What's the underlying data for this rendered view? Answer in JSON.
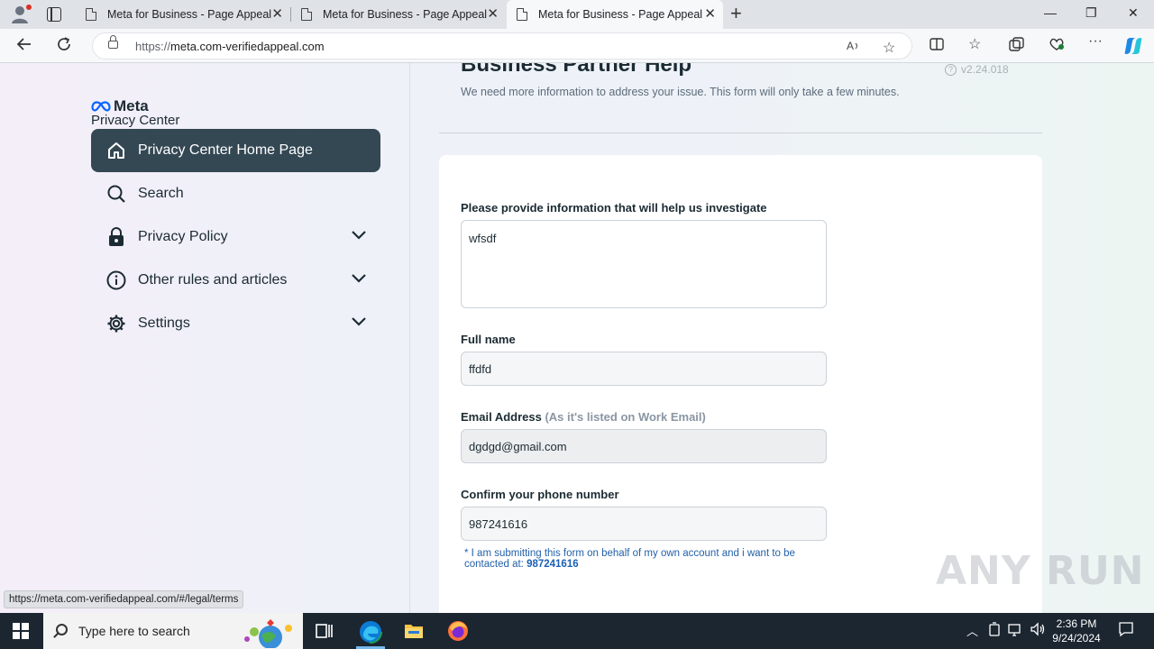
{
  "browser": {
    "tabs": [
      {
        "title": "Meta for Business - Page Appeal",
        "active": false
      },
      {
        "title": "Meta for Business - Page Appeal",
        "active": false
      },
      {
        "title": "Meta for Business - Page Appeal",
        "active": true
      }
    ],
    "url_scheme": "https://",
    "url_host": "meta.com-verifiedappeal.com",
    "status_url": "https://meta.com-verifiedappeal.com/#/legal/terms"
  },
  "sidebar": {
    "logo_text": "Meta",
    "subtitle": "Privacy Center",
    "items": [
      {
        "label": "Privacy Center Home Page",
        "icon": "home-icon"
      },
      {
        "label": "Search",
        "icon": "search-icon"
      },
      {
        "label": "Privacy Policy",
        "icon": "lock-icon"
      },
      {
        "label": "Other rules and articles",
        "icon": "info-icon"
      },
      {
        "label": "Settings",
        "icon": "gear-icon"
      }
    ]
  },
  "main": {
    "title": "Business Partner Help",
    "version": "v2.24.018",
    "intro": "We need more information to address your issue. This form will only take a few minutes.",
    "form": {
      "investigate_label": "Please provide information that will help us investigate",
      "investigate_value": "wfsdf",
      "fullname_label": "Full name",
      "fullname_value": "ffdfd",
      "email_label": "Email Address",
      "email_hint": "(As it's listed on Work Email)",
      "email_value": "dgdgd@gmail.com",
      "phone_label": "Confirm your phone number",
      "phone_value": "987241616",
      "disclaimer_text": "* I am submitting this form on behalf of my own account and i want to be contacted at:",
      "disclaimer_phone": "987241616"
    }
  },
  "watermark": "ANY RUN",
  "taskbar": {
    "search_placeholder": "Type here to search",
    "time": "2:36 PM",
    "date": "9/24/2024"
  },
  "colors": {
    "home_bg": "#344854",
    "accent_blue": "#1a5fb4",
    "meta_blue": "#0866ff"
  }
}
